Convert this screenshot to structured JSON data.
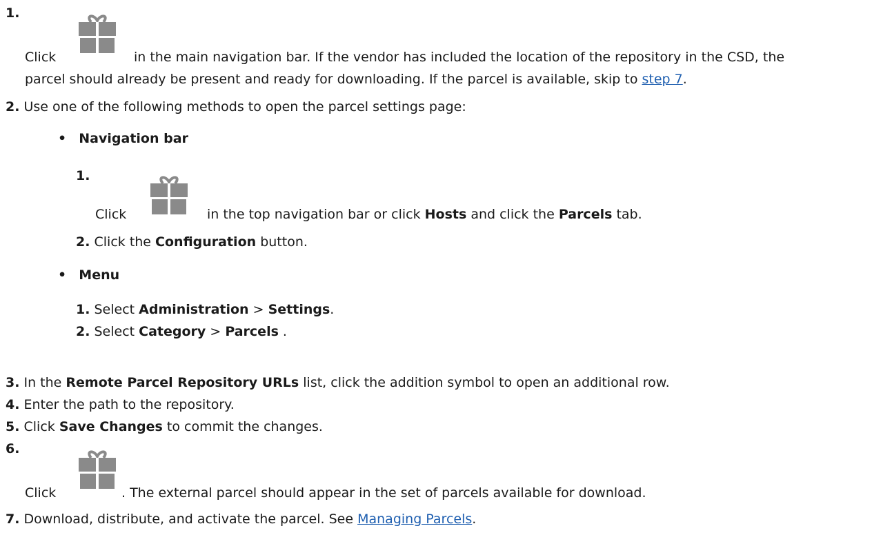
{
  "steps": {
    "s1": {
      "num": "1.",
      "click": "Click",
      "line1": "in the main navigation bar. If the vendor has included the location of the repository in the CSD, the",
      "line2a": "parcel should already be present and ready for downloading. If the parcel is available, skip to ",
      "link": "step 7",
      "line2b": "."
    },
    "s2": {
      "num": "2.",
      "text": "Use one of the following methods to open the parcel settings page:"
    },
    "nav": {
      "bullet_title": "Navigation bar",
      "n1": {
        "num": "1.",
        "click": "Click",
        "t1": "in the top navigation bar or click ",
        "hosts": "Hosts",
        "t2": " and click the ",
        "parcels": "Parcels",
        "t3": " tab."
      },
      "n2": {
        "num": "2.",
        "t1": "Click the ",
        "config": "Configuration",
        "t2": " button."
      }
    },
    "menu": {
      "bullet_title": "Menu",
      "m1": {
        "num": "1.",
        "t1": "Select ",
        "admin": "Administration",
        "sep": " > ",
        "settings": "Settings",
        "t2": "."
      },
      "m2": {
        "num": "2.",
        "t1": "Select ",
        "category": "Category",
        "sep": " > ",
        "parcels": "Parcels",
        "t2": " ."
      }
    },
    "s3": {
      "num": "3.",
      "t1": "In the ",
      "bold": "Remote Parcel Repository URLs",
      "t2": " list, click the addition symbol to open an additional row."
    },
    "s4": {
      "num": "4.",
      "text": "Enter the path to the repository."
    },
    "s5": {
      "num": "5.",
      "t1": "Click ",
      "bold": "Save Changes",
      "t2": " to commit the changes."
    },
    "s6": {
      "num": "6.",
      "click": "Click",
      "text": ". The external parcel should appear in the set of parcels available for download."
    },
    "s7": {
      "num": "7.",
      "t1": "Download, distribute, and activate the parcel. See ",
      "link": "Managing Parcels",
      "t2": "."
    }
  },
  "icons": {
    "parcel": "parcel-gift-icon",
    "color": "#8a8a8a"
  }
}
